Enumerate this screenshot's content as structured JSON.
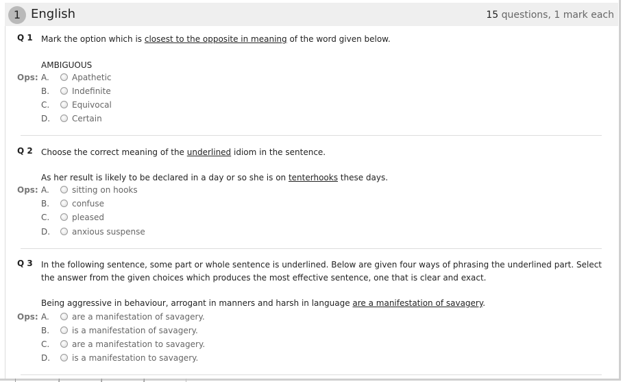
{
  "section": {
    "number": "1",
    "title": "English",
    "count": "15",
    "meta_suffix": " questions, 1 mark each"
  },
  "ops_label": "Ops:",
  "questions": [
    {
      "num": "Q 1",
      "text_pre": "Mark the option which is ",
      "text_underline": "closest to the opposite in meaning",
      "text_post": " of the word given below.",
      "stem_pre": "AMBIGUOUS",
      "stem_underline": "",
      "stem_post": "",
      "options": [
        {
          "letter": "A.",
          "text": "Apathetic"
        },
        {
          "letter": "B.",
          "text": "Indefinite"
        },
        {
          "letter": "C.",
          "text": "Equivocal"
        },
        {
          "letter": "D.",
          "text": "Certain"
        }
      ]
    },
    {
      "num": "Q 2",
      "text_pre": "Choose the correct meaning of the ",
      "text_underline": "underlined",
      "text_post": " idiom in the sentence.",
      "stem_pre": "As her result is likely to be declared in a day or so she is on ",
      "stem_underline": "tenterhooks",
      "stem_post": " these days.",
      "options": [
        {
          "letter": "A.",
          "text": "sitting on hooks"
        },
        {
          "letter": "B.",
          "text": "confuse"
        },
        {
          "letter": "C.",
          "text": "pleased"
        },
        {
          "letter": "D.",
          "text": "anxious suspense"
        }
      ]
    },
    {
      "num": "Q 3",
      "text_pre": "In the following sentence, some part or whole sentence is underlined. Below are given four ways of phrasing the underlined part. Select the answer from the given choices which produces the most effective sentence, one that is clear and exact.",
      "text_underline": "",
      "text_post": "",
      "stem_pre": "Being aggressive in behaviour, arrogant in manners and harsh in language ",
      "stem_underline": "are a manifestation of savagery",
      "stem_post": ".",
      "options": [
        {
          "letter": "A.",
          "text": "are a manifestation of savagery."
        },
        {
          "letter": "B.",
          "text": "is a manifestation of savagery."
        },
        {
          "letter": "C.",
          "text": "are a manifestation to savagery."
        },
        {
          "letter": "D.",
          "text": "is a manifestation to savagery."
        }
      ]
    }
  ]
}
